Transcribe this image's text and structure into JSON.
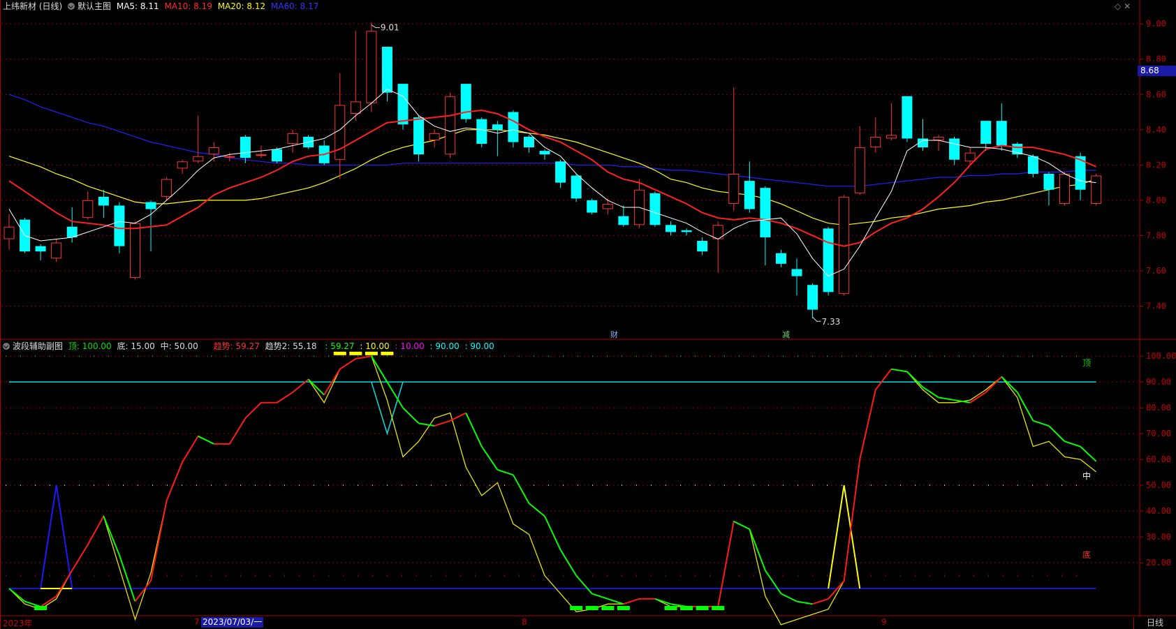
{
  "main_header": {
    "stock": "上纬新材 (日线)",
    "template": "默认主图",
    "ma5": "MA5: 8.11",
    "ma10": "MA10: 8.19",
    "ma20": "MA20: 8.12",
    "ma60": "MA60: 8.17"
  },
  "sub_header": {
    "name": "波段辅助副图",
    "top": "顶: 100.00",
    "bottom": "底: 15.00",
    "mid": "中: 50.00",
    "trend": "趋势: 59.27",
    "trend2": "趋势2: 55.18",
    "v1": ": 59.27",
    "v2": ": 10.00",
    "v3": ": 10.00",
    "v4": ": 90.00",
    "v5": ": 90.00"
  },
  "price_tag": "8.68",
  "high_label": "9.01",
  "low_label": "7.33",
  "event_flags": {
    "cai": "财",
    "jian": "减"
  },
  "sub_axis_labels": {
    "top": "顶",
    "mid": "中",
    "bottom": "底"
  },
  "x_labels": {
    "year": "2023年",
    "m7": "7",
    "date_box": "2023/07/03/一",
    "m8": "8",
    "m9": "9"
  },
  "period_button": "日线",
  "colors": {
    "up": "#ff3232",
    "down": "#00ffff",
    "ma5": "#ffffff",
    "ma10": "#ff2020",
    "ma20": "#ffff00",
    "ma60": "#2020ff"
  },
  "chart_data": [
    {
      "type": "candlestick",
      "ylim": [
        7.22,
        9.06
      ],
      "yticks": [
        7.4,
        7.6,
        7.8,
        8.0,
        8.2,
        8.4,
        8.6,
        8.8,
        9.0
      ],
      "candles": [
        [
          7.78,
          7.85,
          7.72,
          7.92
        ],
        [
          7.89,
          7.71,
          7.7,
          7.9
        ],
        [
          7.74,
          7.71,
          7.66,
          7.75
        ],
        [
          7.67,
          7.76,
          7.65,
          7.78
        ],
        [
          7.85,
          7.79,
          7.76,
          7.96
        ],
        [
          7.9,
          8.0,
          7.89,
          8.05
        ],
        [
          8.02,
          7.97,
          7.9,
          8.06
        ],
        [
          7.97,
          7.74,
          7.7,
          7.99
        ],
        [
          7.56,
          7.87,
          7.55,
          7.88
        ],
        [
          7.99,
          7.95,
          7.71,
          8.0
        ],
        [
          8.02,
          8.12,
          8.0,
          8.13
        ],
        [
          8.18,
          8.22,
          8.15,
          8.23
        ],
        [
          8.22,
          8.25,
          8.21,
          8.48
        ],
        [
          8.26,
          8.3,
          8.22,
          8.33
        ],
        [
          8.25,
          8.25,
          8.22,
          8.27
        ],
        [
          8.36,
          8.24,
          8.21,
          8.37
        ],
        [
          8.26,
          8.26,
          8.24,
          8.31
        ],
        [
          8.29,
          8.22,
          8.21,
          8.3
        ],
        [
          8.32,
          8.38,
          8.27,
          8.4
        ],
        [
          8.36,
          8.3,
          8.29,
          8.37
        ],
        [
          8.31,
          8.21,
          8.2,
          8.34
        ],
        [
          8.23,
          8.54,
          8.12,
          8.72
        ],
        [
          8.49,
          8.56,
          8.45,
          8.96
        ],
        [
          8.55,
          8.96,
          8.5,
          9.01
        ],
        [
          8.87,
          8.61,
          8.56,
          8.87
        ],
        [
          8.66,
          8.43,
          8.4,
          8.66
        ],
        [
          8.47,
          8.26,
          8.22,
          8.48
        ],
        [
          8.34,
          8.38,
          8.3,
          8.4
        ],
        [
          8.26,
          8.59,
          8.24,
          8.61
        ],
        [
          8.66,
          8.46,
          8.44,
          8.66
        ],
        [
          8.46,
          8.32,
          8.3,
          8.47
        ],
        [
          8.43,
          8.4,
          8.25,
          8.45
        ],
        [
          8.5,
          8.33,
          8.3,
          8.51
        ],
        [
          8.36,
          8.3,
          8.27,
          8.37
        ],
        [
          8.28,
          8.26,
          8.23,
          8.29
        ],
        [
          8.22,
          8.1,
          8.07,
          8.23
        ],
        [
          8.14,
          8.01,
          7.99,
          8.15
        ],
        [
          8.0,
          7.93,
          7.92,
          8.01
        ],
        [
          7.95,
          7.98,
          7.92,
          8.01
        ],
        [
          7.91,
          7.86,
          7.85,
          7.97
        ],
        [
          7.86,
          8.06,
          7.84,
          8.12
        ],
        [
          8.04,
          7.86,
          7.85,
          8.05
        ],
        [
          7.86,
          7.82,
          7.8,
          7.88
        ],
        [
          7.83,
          7.82,
          7.8,
          7.84
        ],
        [
          7.77,
          7.71,
          7.69,
          7.79
        ],
        [
          7.78,
          7.86,
          7.59,
          7.88
        ],
        [
          7.98,
          8.15,
          7.94,
          8.64
        ],
        [
          8.11,
          7.95,
          7.93,
          8.22
        ],
        [
          8.07,
          7.79,
          7.63,
          8.08
        ],
        [
          7.7,
          7.64,
          7.62,
          7.72
        ],
        [
          7.61,
          7.57,
          7.46,
          7.67
        ],
        [
          7.52,
          7.38,
          7.33,
          7.53
        ],
        [
          7.84,
          7.48,
          7.46,
          7.85
        ],
        [
          7.47,
          8.02,
          7.46,
          8.03
        ],
        [
          8.04,
          8.3,
          8.03,
          8.42
        ],
        [
          8.3,
          8.36,
          8.27,
          8.47
        ],
        [
          8.35,
          8.37,
          8.34,
          8.55
        ],
        [
          8.59,
          8.35,
          8.33,
          8.59
        ],
        [
          8.35,
          8.3,
          8.28,
          8.46
        ],
        [
          8.34,
          8.36,
          8.28,
          8.37
        ],
        [
          8.35,
          8.23,
          8.2,
          8.36
        ],
        [
          8.22,
          8.27,
          8.2,
          8.3
        ],
        [
          8.45,
          8.32,
          8.28,
          8.45
        ],
        [
          8.45,
          8.31,
          8.28,
          8.55
        ],
        [
          8.32,
          8.26,
          8.24,
          8.33
        ],
        [
          8.25,
          8.15,
          8.13,
          8.26
        ],
        [
          8.15,
          8.06,
          7.97,
          8.16
        ],
        [
          7.98,
          8.15,
          7.97,
          8.16
        ],
        [
          8.25,
          8.06,
          8.0,
          8.27
        ],
        [
          7.98,
          8.14,
          7.97,
          8.15
        ]
      ],
      "ma5": [
        7.95,
        7.8,
        7.77,
        7.78,
        7.79,
        7.82,
        7.85,
        7.88,
        7.87,
        7.92,
        8.0,
        8.08,
        8.17,
        8.24,
        8.26,
        8.27,
        8.28,
        8.29,
        8.31,
        8.33,
        8.35,
        8.4,
        8.48,
        8.55,
        8.63,
        8.59,
        8.48,
        8.42,
        8.39,
        8.41,
        8.4,
        8.38,
        8.4,
        8.38,
        8.3,
        8.25,
        8.15,
        8.07,
        8.0,
        7.96,
        7.96,
        7.93,
        7.9,
        7.87,
        7.82,
        7.78,
        7.84,
        7.88,
        7.89,
        7.9,
        7.81,
        7.67,
        7.57,
        7.61,
        7.74,
        7.9,
        8.05,
        8.28,
        8.34,
        8.34,
        8.32,
        8.3,
        8.3,
        8.29,
        8.27,
        8.25,
        8.21,
        8.15,
        8.11,
        8.1
      ],
      "ma10": [
        8.11,
        8.05,
        7.99,
        7.93,
        7.88,
        7.87,
        7.86,
        7.84,
        7.84,
        7.85,
        7.86,
        7.91,
        7.96,
        8.03,
        8.07,
        8.1,
        8.13,
        8.17,
        8.22,
        8.25,
        8.26,
        8.29,
        8.34,
        8.39,
        8.44,
        8.45,
        8.46,
        8.47,
        8.48,
        8.5,
        8.51,
        8.49,
        8.45,
        8.4,
        8.36,
        8.33,
        8.28,
        8.23,
        8.16,
        8.12,
        8.1,
        8.06,
        8.02,
        7.98,
        7.93,
        7.9,
        7.89,
        7.9,
        7.89,
        7.87,
        7.84,
        7.8,
        7.76,
        7.74,
        7.76,
        7.82,
        7.87,
        7.9,
        7.95,
        8.02,
        8.1,
        8.2,
        8.29,
        8.31,
        8.3,
        8.3,
        8.28,
        8.26,
        8.23,
        8.19
      ],
      "ma20": [
        8.25,
        8.22,
        8.19,
        8.15,
        8.12,
        8.08,
        8.05,
        8.02,
        7.99,
        7.98,
        7.98,
        7.99,
        8.0,
        8.0,
        8.0,
        8.0,
        8.01,
        8.03,
        8.05,
        8.07,
        8.1,
        8.14,
        8.18,
        8.23,
        8.27,
        8.3,
        8.32,
        8.34,
        8.37,
        8.4,
        8.4,
        8.4,
        8.39,
        8.38,
        8.37,
        8.35,
        8.33,
        8.3,
        8.27,
        8.24,
        8.21,
        8.17,
        8.12,
        8.1,
        8.07,
        8.05,
        8.04,
        8.03,
        8.01,
        7.98,
        7.94,
        7.9,
        7.87,
        7.86,
        7.87,
        7.88,
        7.9,
        7.91,
        7.93,
        7.95,
        7.96,
        7.97,
        7.99,
        8.0,
        8.02,
        8.04,
        8.06,
        8.08,
        8.09,
        8.12
      ],
      "ma60": [
        8.6,
        8.57,
        8.53,
        8.5,
        8.47,
        8.44,
        8.42,
        8.39,
        8.36,
        8.33,
        8.31,
        8.29,
        8.27,
        8.26,
        8.24,
        8.23,
        8.22,
        8.21,
        8.21,
        8.2,
        8.2,
        8.2,
        8.2,
        8.2,
        8.2,
        8.21,
        8.21,
        8.21,
        8.21,
        8.21,
        8.21,
        8.21,
        8.21,
        8.21,
        8.21,
        8.21,
        8.2,
        8.2,
        8.2,
        8.19,
        8.19,
        8.18,
        8.17,
        8.17,
        8.16,
        8.15,
        8.14,
        8.13,
        8.12,
        8.11,
        8.1,
        8.09,
        8.08,
        8.08,
        8.08,
        8.09,
        8.1,
        8.11,
        8.12,
        8.13,
        8.13,
        8.14,
        8.14,
        8.15,
        8.15,
        8.16,
        8.16,
        8.16,
        8.17,
        8.17
      ]
    },
    {
      "type": "line",
      "ylim": [
        0,
        106
      ],
      "yticks": [
        20,
        30,
        40,
        50,
        60,
        70,
        80,
        90,
        100
      ],
      "top_line": 90,
      "bottom_line": 10,
      "trend": [
        10,
        5,
        3,
        7,
        17,
        27,
        38,
        23,
        5,
        13,
        44,
        59,
        69,
        66,
        66,
        76,
        82,
        82,
        86,
        91,
        85,
        95,
        99,
        100,
        90,
        80,
        74,
        73,
        75,
        78,
        65,
        56,
        54,
        43,
        38,
        25,
        15,
        8,
        6,
        4,
        6,
        6,
        4,
        3,
        3,
        3,
        36,
        33,
        17,
        8,
        5,
        4,
        6,
        13,
        60,
        87,
        95,
        94,
        88,
        84,
        83,
        82,
        86,
        92,
        86,
        75,
        73,
        67,
        65,
        59.27
      ],
      "trend2": [
        10,
        4,
        2,
        6,
        17,
        27,
        38,
        18,
        -2,
        16,
        44,
        59,
        69,
        66,
        66,
        76,
        82,
        82,
        86,
        91,
        82,
        95,
        99,
        100,
        83,
        61,
        67,
        76,
        78,
        57,
        46,
        51,
        35,
        31,
        15,
        8,
        1,
        2,
        4,
        4,
        6,
        6,
        3,
        3,
        3,
        3,
        36,
        33,
        7,
        -4,
        -2,
        0,
        2,
        13,
        60,
        87,
        95,
        94,
        87,
        82,
        82,
        83,
        87,
        92,
        84,
        65,
        67,
        61,
        60,
        55.18
      ],
      "blue_spike": [
        null,
        null,
        null,
        null,
        null,
        null,
        null,
        null,
        null,
        null,
        null,
        null,
        null,
        null,
        null,
        null,
        null,
        null,
        null,
        null,
        null,
        null,
        null,
        null,
        null,
        null,
        null,
        null,
        null,
        null,
        null,
        null,
        null,
        null,
        null,
        null,
        null,
        null,
        null,
        null,
        null,
        null,
        null,
        null,
        null,
        null,
        null,
        null,
        null,
        null,
        null,
        null,
        null,
        null,
        null,
        null,
        null,
        null,
        null,
        null,
        null,
        null,
        null,
        null,
        null,
        null,
        null,
        null,
        null,
        null
      ],
      "buy_marks": [
        2,
        36,
        37,
        38,
        39,
        42,
        43,
        44,
        45
      ],
      "sell_marks": [
        21,
        22,
        23,
        24
      ]
    }
  ]
}
